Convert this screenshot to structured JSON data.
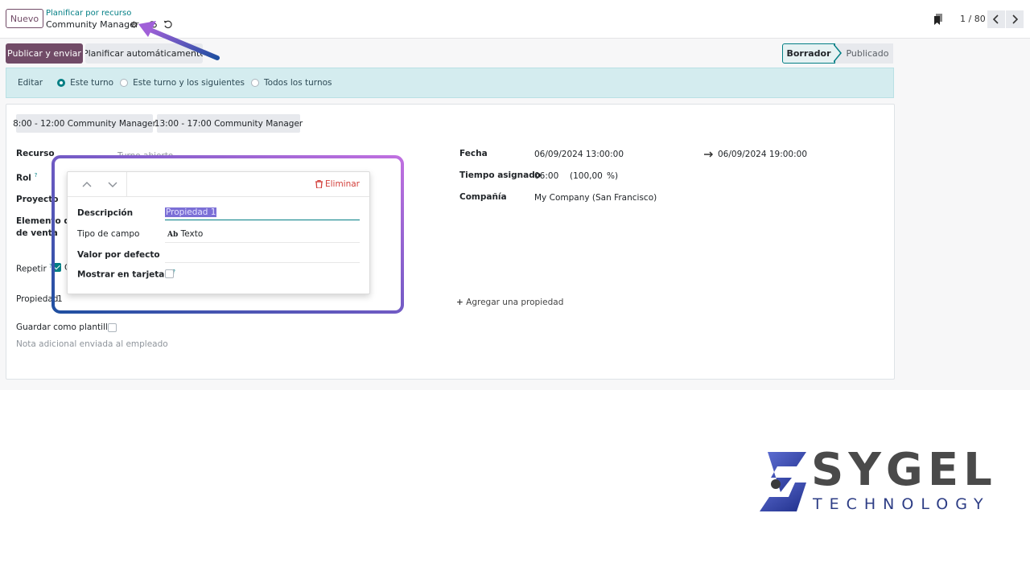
{
  "header": {
    "new_button": "Nuevo",
    "breadcrumb_parent": "Planificar por recurso",
    "breadcrumb_current": "Community Manager",
    "pager": "1 / 80"
  },
  "actions": {
    "publish": "Publicar y enviar",
    "auto_plan": "Planificar automáticamente"
  },
  "status": {
    "steps": [
      "Borrador",
      "Publicado"
    ],
    "active": "Borrador"
  },
  "edit_bar": {
    "label": "Editar",
    "options": [
      "Este turno",
      "Este turno y los siguientes",
      "Todos los turnos"
    ],
    "selected": "Este turno"
  },
  "templates": [
    "8:00 - 12:00 Community Manager",
    "13:00 - 17:00 Community Manager"
  ],
  "form": {
    "recurso_label": "Recurso",
    "recurso_placeholder": "Turno abierto",
    "rol_label": "Rol",
    "proyecto_label": "Proyecto",
    "elemento_label_1": "Elemento del",
    "elemento_label_2": "de venta",
    "repetir_label": "Repetir",
    "repetir_value": "C",
    "propiedad_label": "Propiedad",
    "propiedad_value": "1",
    "plantilla_label": "Guardar como plantilla",
    "nota_placeholder": "Nota adicional enviada al empleado",
    "fecha_label": "Fecha",
    "fecha_start": "06/09/2024 13:00:00",
    "fecha_end": "06/09/2024 19:00:00",
    "tiempo_label": "Tiempo asignado",
    "tiempo_value": "06:00",
    "tiempo_percent": "(100,00",
    "tiempo_percent_unit": "%)",
    "compania_label": "Compañía",
    "compania_value": "My Company (San Francisco)",
    "add_property": "Agregar una propiedad",
    "help_mark": "?"
  },
  "popover": {
    "delete": "Eliminar",
    "descripcion_label": "Descripción",
    "descripcion_value": "Propiedad 1",
    "tipo_label": "Tipo de campo",
    "tipo_icon_text": "Ab",
    "tipo_value": "Texto",
    "valor_label": "Valor por defecto",
    "mostrar_label": "Mostrar en tarjetas"
  },
  "logo": {
    "word": "SYGEL",
    "sub": "TECHNOLOGY"
  },
  "colors": {
    "primary": "#714b67",
    "accent": "#017e84",
    "edit_bar": "#d4ecef",
    "danger": "#d23f3a",
    "highlight_start": "#1f4fa0",
    "highlight_end": "#c070e0",
    "annotation_arrow": "#a060d8"
  }
}
